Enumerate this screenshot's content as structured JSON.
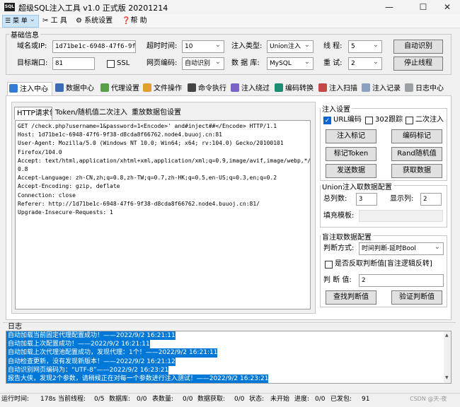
{
  "window": {
    "title": "超级SQL注入工具 v1.0 正式版 20201214",
    "logo": "SQL",
    "minimize": "—",
    "maximize": "☐",
    "close": "✕"
  },
  "menu": [
    {
      "label": "菜 单",
      "icon": "menu-icon"
    },
    {
      "label": "工 具",
      "icon": "tools-icon"
    },
    {
      "label": "系统设置",
      "icon": "gear-icon"
    },
    {
      "label": "帮 助",
      "icon": "help-icon"
    }
  ],
  "basic": {
    "group_label": "基础信息",
    "domain_label": "域名或IP:",
    "domain_value": "1d71be1c-6948-47f6-9f38-d",
    "timeout_label": "超时时间:",
    "timeout_value": "10",
    "inject_type_label": "注入类型:",
    "inject_type_value": "Union注入",
    "threads_label": "线 程:",
    "threads_value": "5",
    "auto_detect": "自动识别",
    "port_label": "目标端口:",
    "port_value": "81",
    "ssl_label": "SSL",
    "encoding_label": "网页编码:",
    "encoding_value": "自动识别",
    "db_label": "数 据 库:",
    "db_value": "MySQL",
    "retry_label": "重 试:",
    "retry_value": "2",
    "stop_thread": "停止线程"
  },
  "tabs": [
    "注入中心",
    "数据中心",
    "代理设置",
    "文件操作",
    "命令执行",
    "注入绕过",
    "编码转换",
    "注入扫描",
    "注入记录",
    "日志中心"
  ],
  "subtabs": [
    "HTTP请求包",
    "Token/随机值",
    "二次注入",
    "重放数据包设置"
  ],
  "request_lines": [
    "GET /check.php?username=1&password=1<Encode>' and#inject##</Encode> HTTP/1.1",
    "Host: 1d71be1c-6948-47f6-9f38-d8cda8f66762.node4.buuoj.cn:81",
    "User-Agent: Mozilla/5.0 (Windows NT 10.0; Win64; x64; rv:104.0) Gecko/20100101",
    "Firefox/104.0",
    "Accept: text/html,application/xhtml+xml,application/xml;q=0.9,image/avif,image/webp,*/*;q=",
    "0.8",
    "Accept-Language: zh-CN,zh;q=0.8,zh-TW;q=0.7,zh-HK;q=0.5,en-US;q=0.3,en;q=0.2",
    "Accept-Encoding: gzip, deflate",
    "Connection: close",
    "Referer: http://1d71be1c-6948-47f6-9f38-d8cda8f66762.node4.buuoj.cn:81/",
    "Upgrade-Insecure-Requests: 1"
  ],
  "inject_settings": {
    "group_label": "注入设置",
    "url_encode": "URL编码",
    "follow_302": "302跟踪",
    "second_inject": "二次注入",
    "mark_inject": "注入标记",
    "mark_encode": "编码标记",
    "mark_token": "标记Token",
    "rand_value": "Rand随机值",
    "send_data": "发送数据",
    "get_data": "获取数据"
  },
  "union": {
    "group_label": "Union注入取数据配置",
    "total_cols_label": "总列数:",
    "total_cols_value": "3",
    "show_col_label": "显示列:",
    "show_col_value": "2",
    "fill_template_label": "填充模板:"
  },
  "blind": {
    "group_label": "盲注取数据配置",
    "judge_label": "判断方式:",
    "judge_value": "时间判断-延时Bool",
    "reverse_label": "是否反取判断值[盲注逻辑反转]",
    "judge_value_label": "判 断 值:",
    "judge_value_value": "2",
    "find_btn": "查找判断值",
    "verify_btn": "验证判断值"
  },
  "log": {
    "label": "日志",
    "lines": [
      "自动加载当前固定代理配置成功！——2022/9/2 16:21:11",
      "自动加载上次配置成功！——2022/9/2 16:21:11",
      "自动加载上次代理池配置成功，发现代理：1个！——2022/9/2 16:21:11",
      "自动检查更新，没有发现新版本！——2022/9/2 16:21:12",
      "自动识别网页编码为：“UTF-8”——2022/9/2 16:23:21",
      "报告大侠，发现2个参数，请稍候正在对每一个参数进行注入测试！——2022/9/2 16:23:21"
    ]
  },
  "status": {
    "runtime_label": "运行时间:",
    "runtime_value": "178s",
    "cur_task_label": "当前线程:",
    "cur_task_value": "0/5",
    "db_label": "数据库:",
    "db_value": "0/0",
    "table_label": "表数量:",
    "table_value": "0/0",
    "getdata_label": "数据获取:",
    "getdata_value": "0/0",
    "state_label": "状态:",
    "state_value": "未开始",
    "progress_label": "进度:",
    "progress_value": "0/0",
    "sent_label": "已发包:",
    "sent_value": "91",
    "watermark": "CSDN @天-夜"
  }
}
